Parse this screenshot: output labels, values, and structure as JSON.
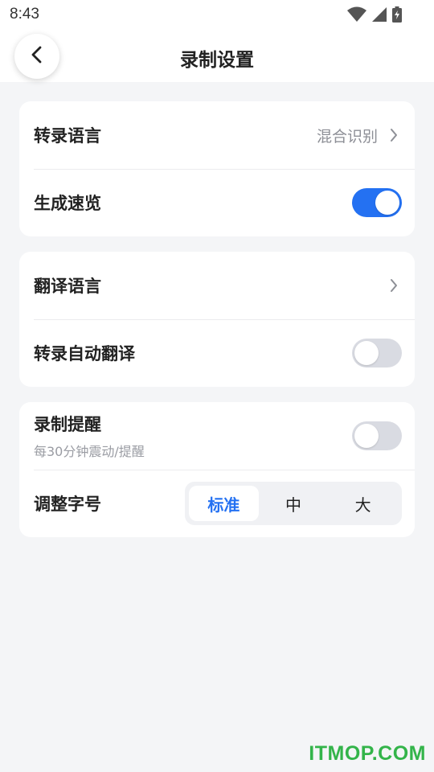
{
  "status_bar": {
    "time": "8:43"
  },
  "header": {
    "title": "录制设置"
  },
  "card1": {
    "transcribe_language": {
      "label": "转录语言",
      "value": "混合识别"
    },
    "generate_overview": {
      "label": "生成速览",
      "enabled": true
    }
  },
  "card2": {
    "translate_language": {
      "label": "翻译语言"
    },
    "auto_translate": {
      "label": "转录自动翻译",
      "enabled": false
    }
  },
  "card3": {
    "record_reminder": {
      "label": "录制提醒",
      "sub": "每30分钟震动/提醒",
      "enabled": false
    },
    "font_size": {
      "label": "调整字号",
      "options": [
        "标准",
        "中",
        "大"
      ],
      "selected": "标准"
    }
  },
  "watermark": "ITMOP.COM",
  "colors": {
    "accent": "#2471f2",
    "toggle_off": "#d9dbe2",
    "background": "#f4f5f7",
    "watermark": "#33b44a"
  }
}
